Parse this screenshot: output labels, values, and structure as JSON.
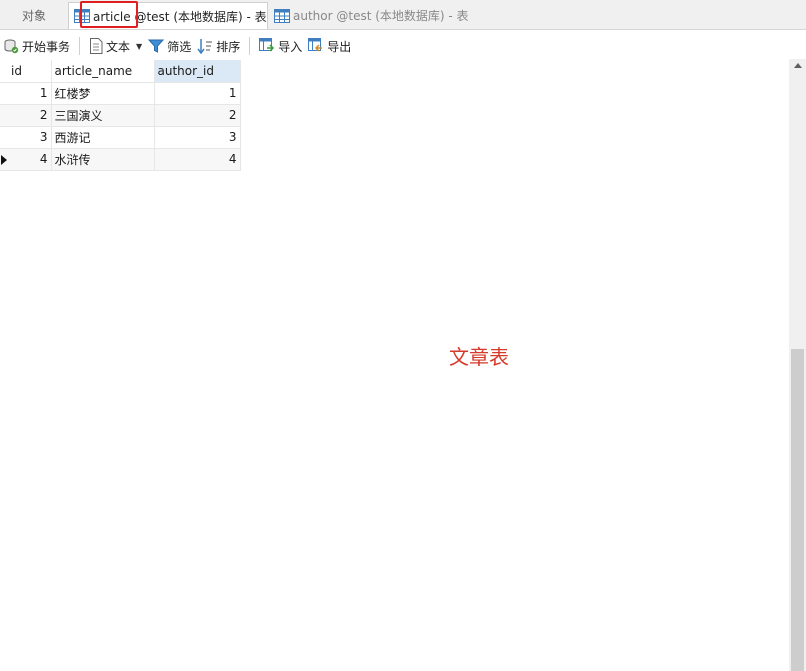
{
  "tabs": {
    "objects": "对象",
    "article_tab": "article @test (本地数据库) - 表",
    "author_tab": "author @test (本地数据库) - 表"
  },
  "toolbar": {
    "begin_transaction": "开始事务",
    "text": "文本",
    "filter": "筛选",
    "sort": "排序",
    "import": "导入",
    "export": "导出"
  },
  "grid": {
    "columns": [
      "id",
      "article_name",
      "author_id"
    ],
    "rows": [
      {
        "id": "1",
        "article_name": "红楼梦",
        "author_id": "1"
      },
      {
        "id": "2",
        "article_name": "三国演义",
        "author_id": "2"
      },
      {
        "id": "3",
        "article_name": "西游记",
        "author_id": "3"
      },
      {
        "id": "4",
        "article_name": "水浒传",
        "author_id": "4"
      }
    ]
  },
  "annotation": "文章表",
  "colors": {
    "highlight": "#e02020",
    "annotation": "#d63a2a",
    "selected_header": "#dbe9f6"
  }
}
